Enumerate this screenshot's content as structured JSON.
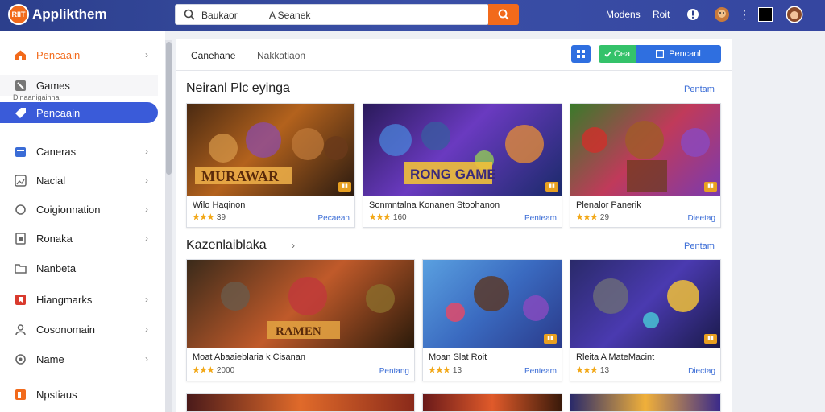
{
  "header": {
    "logo_text": "RIIT",
    "app_title": "Applikthem",
    "search_text_1": "Baukaor",
    "search_text_2": "A Seanek",
    "links": [
      "Modens",
      "Roit"
    ]
  },
  "sidebar": {
    "items": [
      {
        "label": "Pencaain",
        "color": "#f26a1b",
        "chevron": true,
        "highlight": true
      },
      {
        "label": "Games",
        "color": "#777",
        "chevron": false
      },
      {
        "label": "Pencaain",
        "color": "#fff",
        "chevron": false,
        "active": true
      },
      {
        "label": "Caneras",
        "color": "#3a6cd6",
        "chevron": true
      },
      {
        "label": "Nacial",
        "color": "#777",
        "chevron": true
      },
      {
        "label": "Coigionnation",
        "color": "#777",
        "chevron": true
      },
      {
        "label": "Ronaka",
        "color": "#777",
        "chevron": true
      },
      {
        "label": "Nanbeta",
        "color": "#777",
        "chevron": false
      },
      {
        "label": "Hiangmarks",
        "color": "#d93a2e",
        "chevron": true
      },
      {
        "label": "Cosonomain",
        "color": "#777",
        "chevron": true
      },
      {
        "label": "Name",
        "color": "#777",
        "chevron": true
      },
      {
        "label": "Npstiaus",
        "color": "#f26a1b",
        "chevron": false
      }
    ],
    "subtext": "Dinaanigainna"
  },
  "tabs": [
    "Canehane",
    "Nakkatiaon"
  ],
  "toolbar": {
    "green_label": "Cea",
    "primary_label": "Pencanl"
  },
  "sections": [
    {
      "title": "Neiranl Plc eyinga",
      "see_all": "Pentam",
      "cards": [
        {
          "title": "Wilo Haqinon",
          "rating": "★★★",
          "score": "39",
          "action": "Pecaean",
          "art": "MURAWAR"
        },
        {
          "title": "Sonmntalna Konanen Stoohanon",
          "rating": "★★★",
          "score": "160",
          "action": "Penteam",
          "art": "RONG GAME"
        },
        {
          "title": "Plenalor Panerik",
          "rating": "★★★",
          "score": "29",
          "action": "Dieetag",
          "art": ""
        }
      ]
    },
    {
      "title": "Kazenlaiblaka",
      "see_all": "Pentam",
      "cards": [
        {
          "title": "Moat Abaaieblaria k Cisanan",
          "rating": "★★★",
          "score": "2000",
          "action": "Pentang",
          "art": "RAMEN"
        },
        {
          "title": "Moan Slat Roit",
          "rating": "★★★",
          "score": "13",
          "action": "Penteam",
          "art": ""
        },
        {
          "title": "Rleita A MateMacint",
          "rating": "★★★",
          "score": "13",
          "action": "Diectag",
          "art": ""
        }
      ]
    }
  ]
}
